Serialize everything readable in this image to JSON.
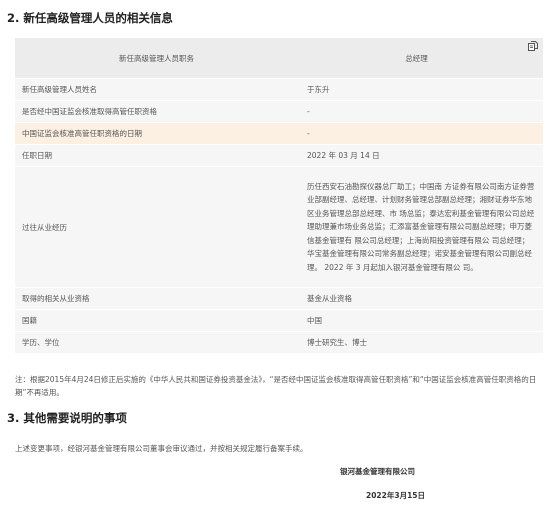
{
  "section2": {
    "title": "2. 新任高级管理人员的相关信息"
  },
  "table": {
    "header": {
      "label": "新任高级管理人员职务",
      "value": "总经理",
      "icon": "copy-icon"
    },
    "rows": [
      {
        "label": "新任高级管理人员姓名",
        "value": "于东升"
      },
      {
        "label": "是否经中国证监会核准取得高管任职资格",
        "value": "-"
      },
      {
        "label": "中国证监会核准高管任职资格的日期",
        "value": "-"
      },
      {
        "label": "任职日期",
        "value": "2022 年 03 月 14 日"
      },
      {
        "label": "过往从业经历",
        "value": "历任西安石油勘探仪器总厂助工；中国南 方证券有限公司南方证券营业部副经理、总经理、计划财务管理总部副总经理；湘财证券华东地区业务管理总部总经理、市 场总监；泰达宏利基金管理有限公司总经 理助理兼市场业务总监；汇添富基金管理有限公司副总经理；申万菱信基金管理有 限公司总经理；上海尚阳投资管理有限公 司总经理；华宝基金管理有限公司常务副总经理；诺安基金管理有限公司副总经理。 2022 年 3 月起加入银河基金管理有限公 司。"
      },
      {
        "label": "取得的相关从业资格",
        "value": "基金从业资格"
      },
      {
        "label": "国籍",
        "value": "中国"
      },
      {
        "label": "学历、学位",
        "value": "博士研究生、博士"
      }
    ]
  },
  "note": "注：根据2015年4月24日修正后实施的《中华人民共和国证券投资基金法》，“是否经中国证监会核准取得高管任职资格”和“中国证监会核准高管任职资格的日期”不再适用。",
  "section3": {
    "title": "3. 其他需要说明的事项",
    "statement": "上述变更事项，经银河基金管理有限公司董事会审议通过，并按相关规定履行备案手续。",
    "company": "银河基金管理有限公司",
    "date": "2022年3月15日"
  },
  "colors": {
    "header_bg": "#ececec",
    "row_bg": "#f6f6f6",
    "highlight_bg": "#fcf0e2",
    "text": "#555555"
  }
}
